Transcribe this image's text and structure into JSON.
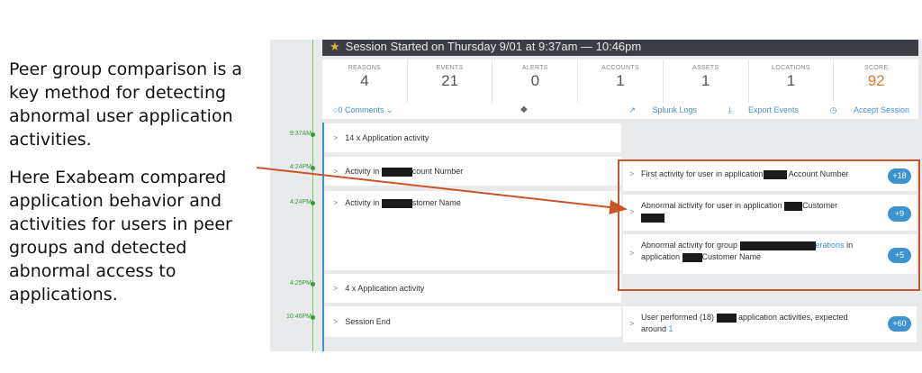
{
  "explanation": {
    "para1": "Peer group comparison is a key method for detecting abnormal user application activities.",
    "para2": "Here Exabeam compared application behavior and activities for users in peer groups and detected abnormal access to applications."
  },
  "session": {
    "title": "Session Started on Thursday 9/01 at 9:37am — 10:46pm"
  },
  "stats": [
    {
      "label": "REASONS",
      "value": "4"
    },
    {
      "label": "EVENTS",
      "value": "21"
    },
    {
      "label": "ALERTS",
      "value": "0"
    },
    {
      "label": "ACCOUNTS",
      "value": "1"
    },
    {
      "label": "ASSETS",
      "value": "1"
    },
    {
      "label": "LOCATIONS",
      "value": "1"
    },
    {
      "label": "SCORE",
      "value": "92"
    }
  ],
  "toolbar": {
    "comments": "0 Comments",
    "splunk": "Splunk Logs",
    "export": "Export Events",
    "accept": "Accept Session"
  },
  "timeline": {
    "t1": "9:37AM",
    "t2": "4:24PM",
    "t3": "4:24PM",
    "t4": "4:25PM",
    "t5": "10:46PM",
    "e1": "14 x Application activity",
    "e2_pre": "Activity in ",
    "e2_post": "count Number",
    "e3_pre": "Activity in ",
    "e3_post": "stomer Name",
    "e4": "4 x Application activity",
    "e5": "Session End"
  },
  "reasons": {
    "r1_pre": "First activity for user in application",
    "r1_post": " Account Number",
    "r1_score": "+18",
    "r2_pre": "Abnormal activity for user in application ",
    "r2_post": "Customer",
    "r2_score": "+9",
    "r3_pre": "Abnormal activity for group ",
    "r3_link": "erations",
    "r3_mid": " in",
    "r3_line2_pre": "application ",
    "r3_line2_post": "Customer Name",
    "r3_score": "+5",
    "r4_pre": "User performed (18) ",
    "r4_post": " application activities, expected",
    "r4_line2": "around ",
    "r4_link": "1",
    "r4_score": "+60"
  },
  "colors": {
    "accent": "#3c93cf",
    "highlight": "#c8552a",
    "timeline_green": "#3a9a3a",
    "score": "#e07a2e"
  }
}
